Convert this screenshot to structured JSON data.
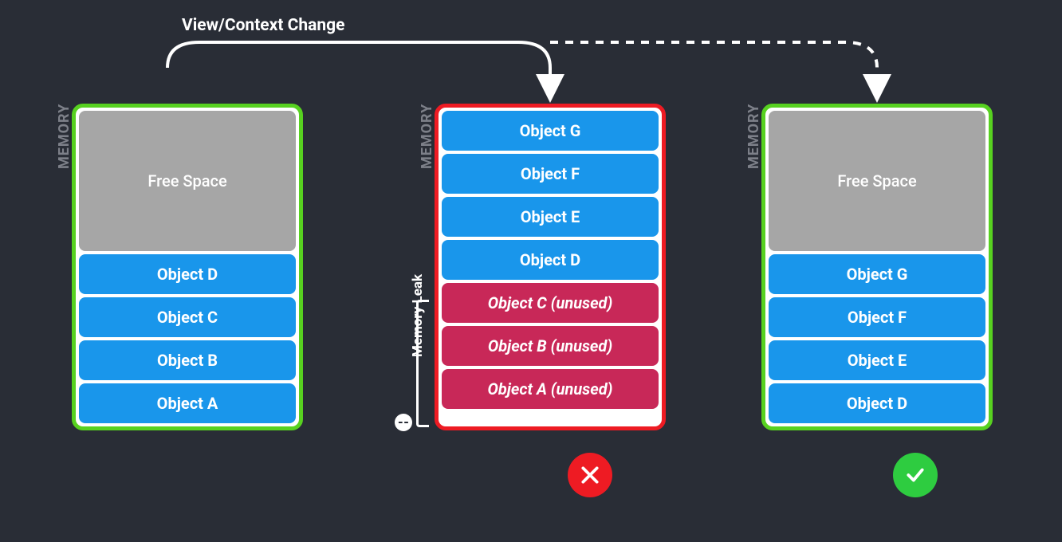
{
  "title": "View/Context Change",
  "memory_label": "MEMORY",
  "leak_label": "Memory Leak",
  "leak_badge": "--",
  "free_space_label": "Free Space",
  "colors": {
    "background": "#292d36",
    "box_good": "#57d120",
    "box_bad": "#ee1b23",
    "object_blue": "#1996eb",
    "object_leak": "#c82858",
    "free_space": "#a6a6a6",
    "badge_good": "#2ecc40",
    "badge_bad": "#ee1b23"
  },
  "columns": {
    "left": {
      "border": "green",
      "has_free_space": true,
      "items": [
        {
          "label": "Object D",
          "style": "blue"
        },
        {
          "label": "Object C",
          "style": "blue"
        },
        {
          "label": "Object B",
          "style": "blue"
        },
        {
          "label": "Object A",
          "style": "blue"
        }
      ]
    },
    "mid": {
      "border": "red",
      "has_free_space": false,
      "items": [
        {
          "label": "Object G",
          "style": "blue"
        },
        {
          "label": "Object F",
          "style": "blue"
        },
        {
          "label": "Object E",
          "style": "blue"
        },
        {
          "label": "Object D",
          "style": "blue"
        },
        {
          "label": "Object C (unused)",
          "style": "leak"
        },
        {
          "label": "Object B (unused)",
          "style": "leak"
        },
        {
          "label": "Object A (unused)",
          "style": "leak"
        }
      ]
    },
    "right": {
      "border": "green",
      "has_free_space": true,
      "items": [
        {
          "label": "Object G",
          "style": "blue"
        },
        {
          "label": "Object F",
          "style": "blue"
        },
        {
          "label": "Object E",
          "style": "blue"
        },
        {
          "label": "Object D",
          "style": "blue"
        }
      ]
    }
  },
  "arrows": {
    "solid": {
      "from": "left",
      "to": "mid"
    },
    "dashed": {
      "from": "mid_branch",
      "to": "right"
    }
  }
}
